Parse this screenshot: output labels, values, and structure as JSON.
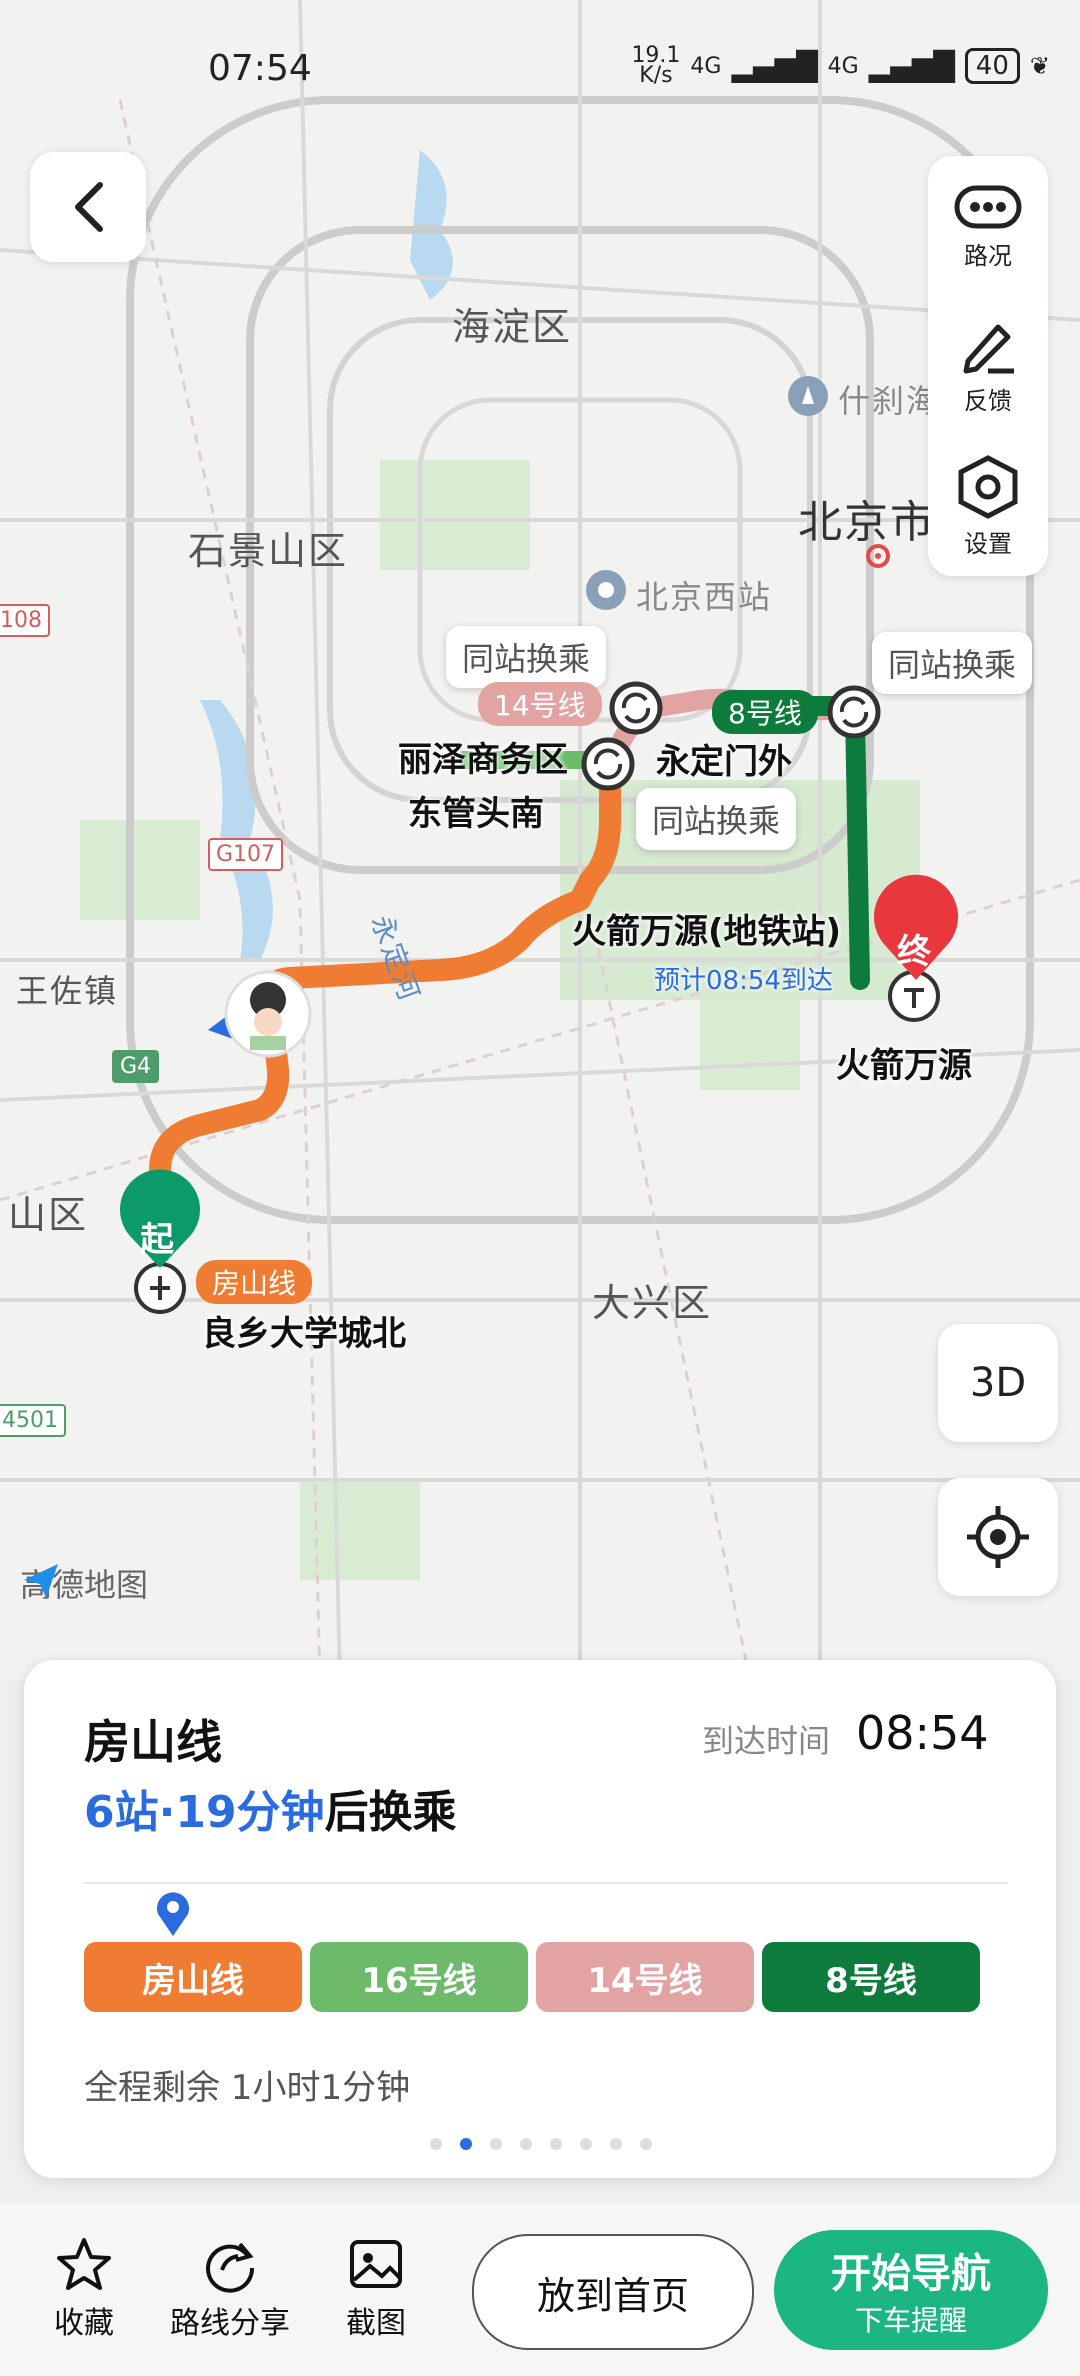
{
  "status_bar": {
    "time": "07:54",
    "net_speed_top": "19.1",
    "net_speed_bottom": "K/s",
    "network_1": "4G",
    "network_2": "4G",
    "battery": "40"
  },
  "map": {
    "districts": [
      "海淀区",
      "石景山区",
      "北京市",
      "大兴区",
      "王佐镇",
      "山区"
    ],
    "poi": {
      "shichahai": "什刹海",
      "beijing_west": "北京西站"
    },
    "river": "永定河",
    "road_badges": [
      "G107",
      "G4",
      "4501",
      "108"
    ],
    "transfer_bubbles": [
      "同站换乘",
      "同站换乘",
      "同站换乘"
    ],
    "line_tags": {
      "line14": "14号线",
      "line8": "8号线",
      "fangshan": "房山线"
    },
    "stations": {
      "lize": "丽泽商务区",
      "dongguantou": "东管头南",
      "yongdingmen": "永定门外",
      "huojian_subway": "火箭万源(地铁站)",
      "eta": "预计08:54到达",
      "huojian": "火箭万源",
      "start": "良乡大学城北"
    },
    "start_marker": "起",
    "end_marker": "终",
    "logo": "高德地图",
    "btn_3d": "3D"
  },
  "side_panel": {
    "traffic": "路况",
    "feedback": "反馈",
    "settings": "设置"
  },
  "route_card": {
    "line_name": "房山线",
    "arrive_label": "到达时间",
    "arrive_time": "08:54",
    "stops_text": "6站·19分钟",
    "transfer_text": "后换乘",
    "segments": [
      {
        "name": "房山线",
        "color": "#f07b33"
      },
      {
        "name": "16号线",
        "color": "#6cba6a"
      },
      {
        "name": "14号线",
        "color": "#e2a3a3"
      },
      {
        "name": "8号线",
        "color": "#0d7b3b"
      }
    ],
    "remaining": "全程剩余 1小时1分钟"
  },
  "bottom_bar": {
    "favorite": "收藏",
    "share": "路线分享",
    "screenshot": "截图",
    "home": "放到首页",
    "nav_title": "开始导航",
    "nav_sub": "下车提醒"
  },
  "colors": {
    "accent_green": "#1bb682",
    "blue": "#2b6be0"
  }
}
